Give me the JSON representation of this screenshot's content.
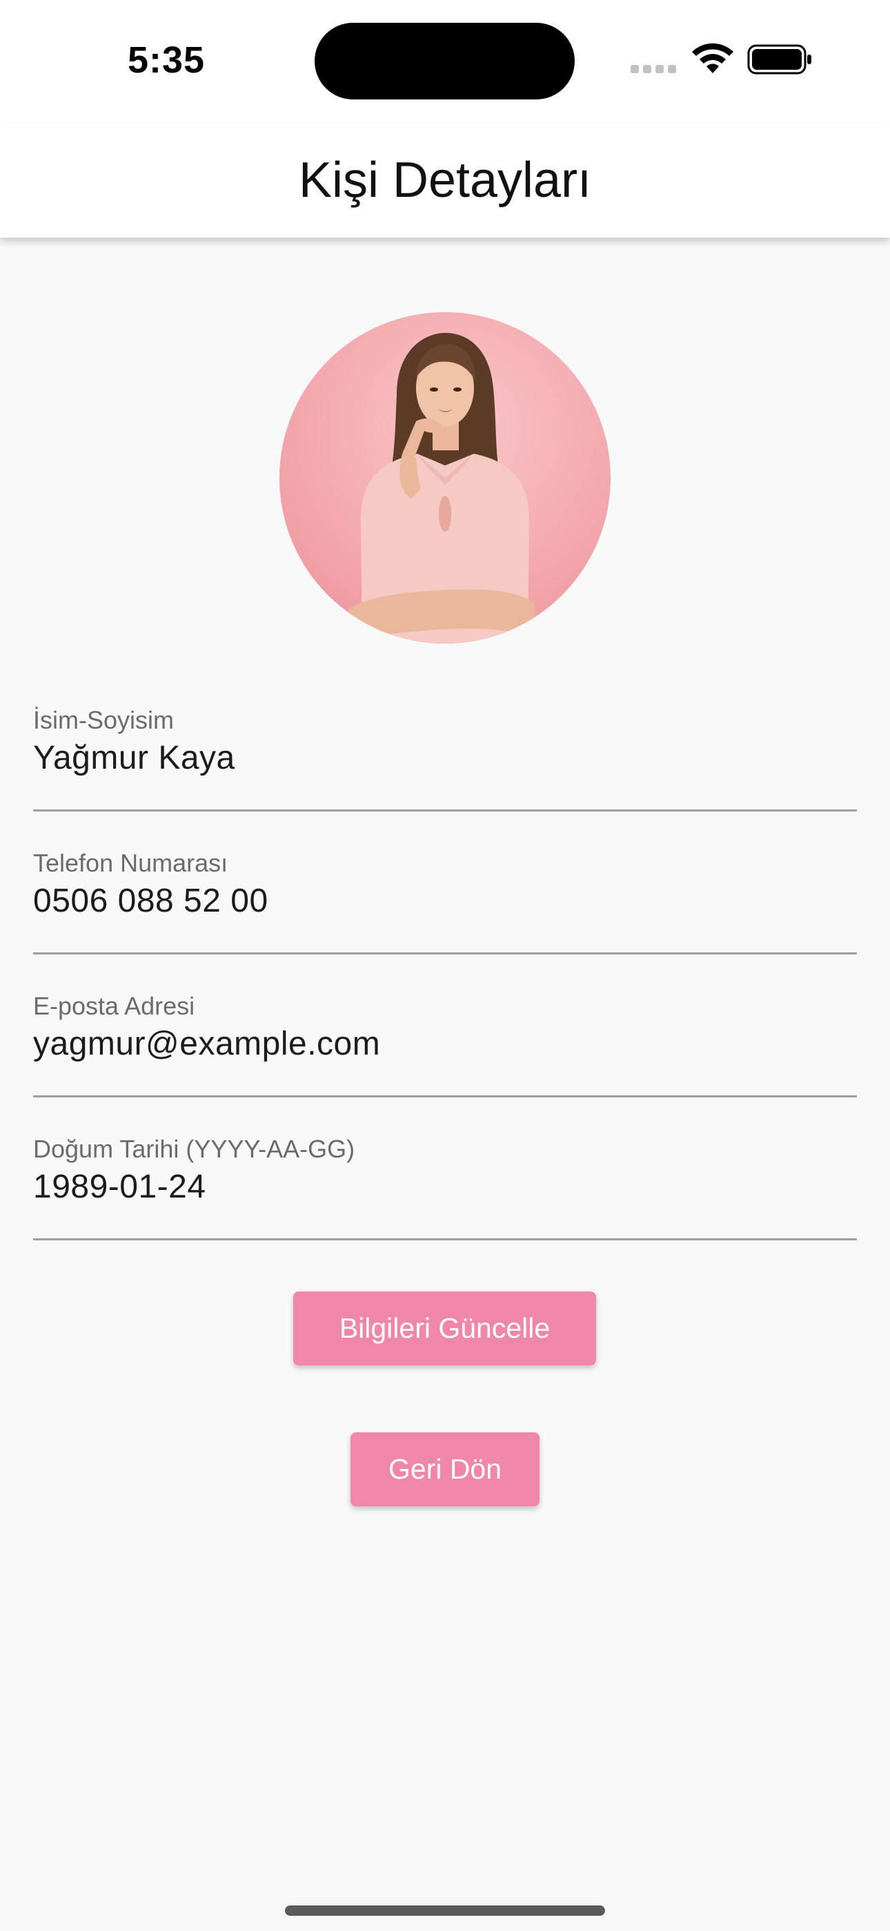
{
  "status_bar": {
    "time": "5:35",
    "icons": [
      "signal-icon",
      "wifi-icon",
      "battery-icon"
    ]
  },
  "app_bar": {
    "title": "Kişi Detayları"
  },
  "avatar": {
    "icon": "profile-photo"
  },
  "form": {
    "fields": [
      {
        "label": "İsim-Soyisim",
        "value": "Yağmur Kaya"
      },
      {
        "label": "Telefon Numarası",
        "value": "0506 088 52 00"
      },
      {
        "label": "E-posta Adresi",
        "value": "yagmur@example.com"
      },
      {
        "label": "Doğum Tarihi (YYYY-AA-GG)",
        "value": "1989-01-24"
      }
    ]
  },
  "buttons": {
    "update_label": "Bilgileri Güncelle",
    "back_label": "Geri Dön"
  },
  "colors": {
    "accent": "#f186ab",
    "background": "#f8f8f8",
    "underline": "#9e9e9e"
  }
}
